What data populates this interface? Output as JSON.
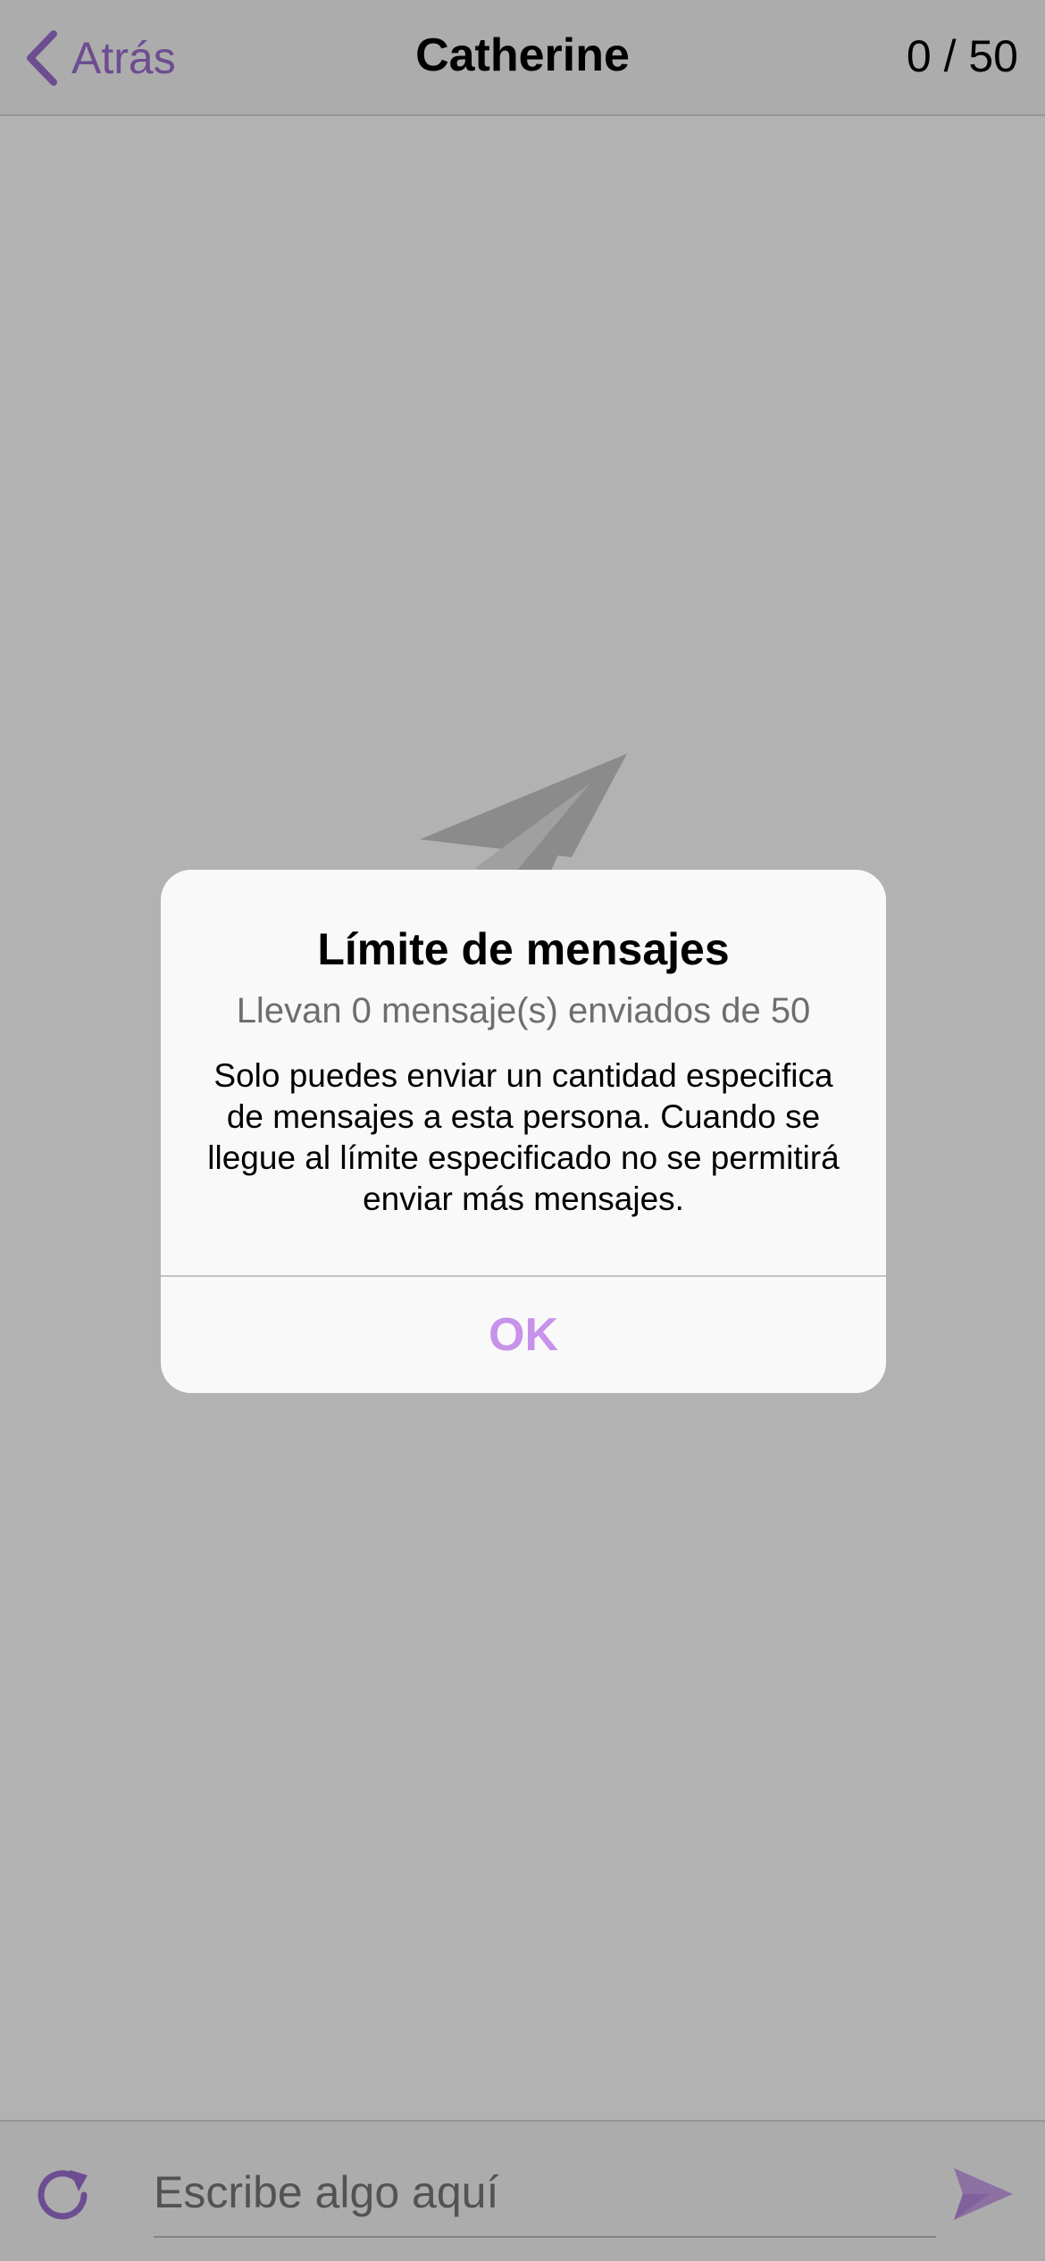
{
  "header": {
    "back_label": "Atrás",
    "title": "Catherine",
    "counter": "0 / 50"
  },
  "composer": {
    "placeholder": "Escribe algo aquí"
  },
  "dialog": {
    "title": "Límite de mensajes",
    "subtitle": "Llevan 0 mensaje(s) enviados de 50",
    "body": "Solo puedes enviar un cantidad especifica de mensajes a esta persona. Cuando se llegue al límite especificado no se permitirá enviar más mensajes.",
    "ok_label": "OK"
  },
  "colors": {
    "accent": "#9c6fd0",
    "ok_button": "#c792ea",
    "overlay": "rgba(0,0,0,0.30)",
    "dialog_background": "#f9f9f9"
  },
  "icons": {
    "back": "chevron-left-icon",
    "empty_state": "paper-plane-icon",
    "refresh": "refresh-icon",
    "send": "send-icon"
  }
}
